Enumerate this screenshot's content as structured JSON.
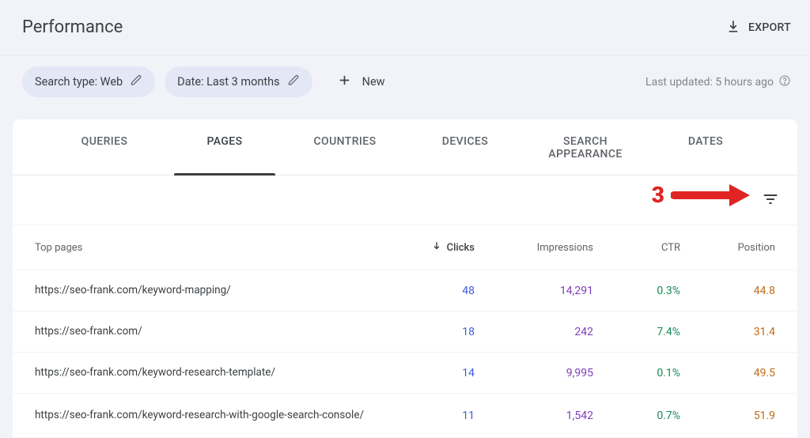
{
  "header": {
    "title": "Performance",
    "export_label": "EXPORT"
  },
  "filters": {
    "search_type_chip": "Search type: Web",
    "date_chip": "Date: Last 3 months",
    "new_label": "New",
    "last_updated": "Last updated: 5 hours ago"
  },
  "tabs": [
    "QUERIES",
    "PAGES",
    "COUNTRIES",
    "DEVICES",
    "SEARCH APPEARANCE",
    "DATES"
  ],
  "active_tab_index": 1,
  "annotation": {
    "label": "3"
  },
  "table": {
    "col_pages": "Top pages",
    "col_clicks": "Clicks",
    "col_impressions": "Impressions",
    "col_ctr": "CTR",
    "col_position": "Position",
    "rows": [
      {
        "url": "https://seo-frank.com/keyword-mapping/",
        "clicks": "48",
        "impressions": "14,291",
        "ctr": "0.3%",
        "position": "44.8"
      },
      {
        "url": "https://seo-frank.com/",
        "clicks": "18",
        "impressions": "242",
        "ctr": "7.4%",
        "position": "31.4"
      },
      {
        "url": "https://seo-frank.com/keyword-research-template/",
        "clicks": "14",
        "impressions": "9,995",
        "ctr": "0.1%",
        "position": "49.5"
      },
      {
        "url": "https://seo-frank.com/keyword-research-with-google-search-console/",
        "clicks": "11",
        "impressions": "1,542",
        "ctr": "0.7%",
        "position": "51.9"
      }
    ]
  }
}
